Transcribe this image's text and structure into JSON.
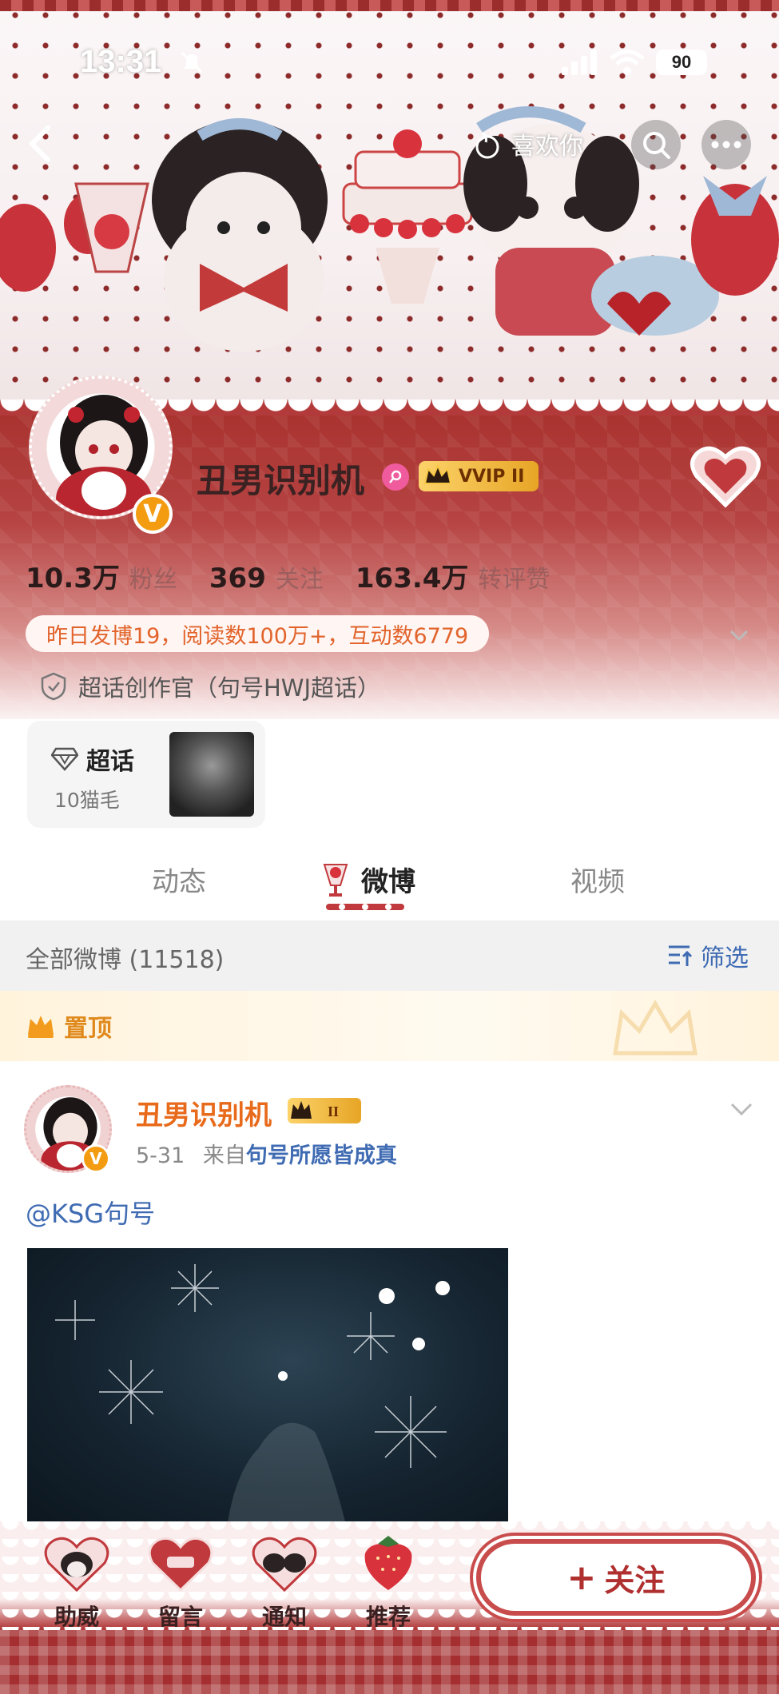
{
  "status_bar": {
    "time": "13:31",
    "battery": "90"
  },
  "header": {
    "like_you_label": "喜欢你"
  },
  "profile": {
    "username": "丑男识别机",
    "vvip_label": "VVIP II",
    "stats": [
      {
        "num": "10.3万",
        "label": "粉丝"
      },
      {
        "num": "369",
        "label": "关注"
      },
      {
        "num": "163.4万",
        "label": "转评赞"
      }
    ],
    "activity": "昨日发博19，阅读数100万+，互动数6779",
    "creator_title": "超话创作官（句号HWJ超话）",
    "supertopic": {
      "title": "超话",
      "subtitle": "10猫毛"
    }
  },
  "tabs": [
    {
      "label": "动态"
    },
    {
      "label": "微博"
    },
    {
      "label": "视频"
    }
  ],
  "filter_bar": {
    "title": "全部微博 (11518)",
    "filter_label": "筛选"
  },
  "pinned": {
    "label": "置顶"
  },
  "post": {
    "author": "丑男识别机",
    "date": "5-31",
    "from_prefix": "来自",
    "source": "句号所愿皆成真",
    "text": "@KSG句号"
  },
  "bottom_bar": {
    "items": [
      {
        "label": "助威"
      },
      {
        "label": "留言"
      },
      {
        "label": "通知"
      },
      {
        "label": "推荐"
      }
    ],
    "follow_label": "关注"
  },
  "colors": {
    "accent_red": "#b33a3a",
    "link_blue": "#3f6bb3",
    "orange": "#e86a1b"
  }
}
